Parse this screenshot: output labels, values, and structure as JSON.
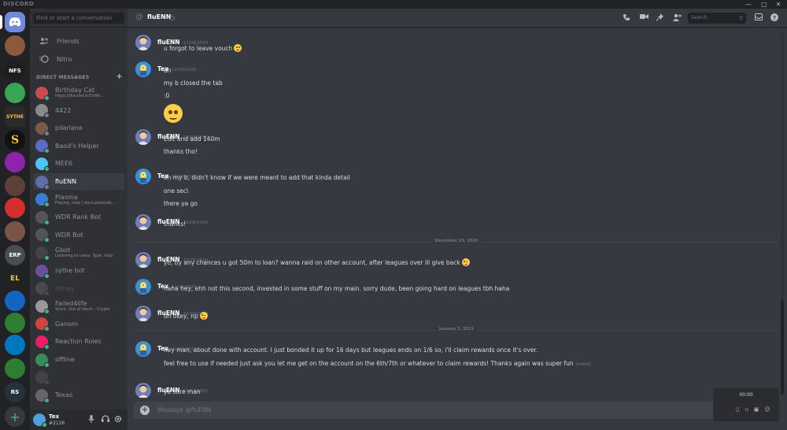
{
  "app": {
    "brand": "DISCORD"
  },
  "colors": {
    "accent": "#7289da",
    "online": "#43b581",
    "idle": "#faa61a",
    "dnd": "#f04747"
  },
  "window_controls": [
    "minimize-icon",
    "maximize-icon",
    "close-icon"
  ],
  "guilds": [
    {
      "label": "",
      "icon": "discord-home-icon"
    },
    {
      "label": "",
      "icon": "server-icon"
    },
    {
      "label": "NFS",
      "icon": "server-icon"
    },
    {
      "label": "",
      "icon": "server-icon"
    },
    {
      "label": "SYTHE",
      "icon": "server-icon"
    },
    {
      "label": "S",
      "icon": "server-icon"
    },
    {
      "label": "",
      "icon": "server-icon"
    },
    {
      "label": "",
      "icon": "server-icon"
    },
    {
      "label": "",
      "icon": "server-icon"
    },
    {
      "label": "",
      "icon": "server-icon"
    },
    {
      "label": "ERP",
      "icon": "server-icon"
    },
    {
      "label": "EL",
      "icon": "server-icon"
    },
    {
      "label": "",
      "icon": "server-icon"
    },
    {
      "label": "",
      "icon": "server-icon"
    },
    {
      "label": "",
      "icon": "server-icon"
    },
    {
      "label": "",
      "icon": "server-icon"
    },
    {
      "label": "RS",
      "icon": "server-icon"
    },
    {
      "label": "+",
      "icon": "add-server-icon"
    }
  ],
  "sidebar": {
    "search_placeholder": "Find or start a conversation",
    "nav": [
      {
        "label": "Friends",
        "icon": "friends-icon"
      },
      {
        "label": "Nitro",
        "icon": "nitro-icon"
      }
    ],
    "dm_header": "DIRECT MESSAGES",
    "dms": [
      {
        "name": "Birthday Cat",
        "sub": "https://discord.io/Orifle...",
        "status": "online",
        "color": "#c74b50"
      },
      {
        "name": "4422",
        "sub": "",
        "status": "offline",
        "color": "#8a8a8a"
      },
      {
        "name": "pilarlane",
        "sub": "",
        "status": "offline",
        "color": "#7a5a4a"
      },
      {
        "name": "Baod's Helper",
        "sub": "",
        "status": "online",
        "color": "#5c6bc0"
      },
      {
        "name": "MEE6",
        "sub": "",
        "status": "online",
        "color": "#4fc3f7"
      },
      {
        "name": "fluENN",
        "sub": "",
        "status": "offline",
        "color": "#5b6ea5",
        "active": true
      },
      {
        "name": "Plasma",
        "sub": "Playing .help | docs.plasmab...",
        "status": "online",
        "color": "#3a7bd5"
      },
      {
        "name": "WDR Rank Bot",
        "sub": "",
        "status": "online",
        "color": "#555"
      },
      {
        "name": "WDR Bot",
        "sub": "",
        "status": "online",
        "color": "#555"
      },
      {
        "name": "Gbot",
        "sub": "Listening to users. Type .help",
        "status": "online",
        "color": "#444"
      },
      {
        "name": "sythe bot",
        "sub": "",
        "status": "online",
        "color": "#6b4f9e"
      },
      {
        "name": "Winey",
        "sub": "",
        "status": "offline",
        "color": "#777",
        "faded": true
      },
      {
        "name": "Failed4life",
        "sub": "Stock: Out of Stock - Crypto",
        "status": "online",
        "color": "#999"
      },
      {
        "name": "Ganom",
        "sub": "",
        "status": "online",
        "color": "#d0443e"
      },
      {
        "name": "Reaction Roles",
        "sub": "",
        "status": "online",
        "color": "#e91e63"
      },
      {
        "name": "offline",
        "sub": "",
        "status": "online",
        "color": "#3b8a5a"
      },
      {
        "name": "",
        "sub": "",
        "status": "offline",
        "color": "#666",
        "faded": true
      },
      {
        "name": "Texas",
        "sub": "",
        "status": "online",
        "color": "#666"
      }
    ],
    "user": {
      "name": "Tex",
      "tag": "#2126"
    }
  },
  "header": {
    "channel": "fluENN",
    "search_placeholder": "Search"
  },
  "messages": [
    {
      "author": "fluENN",
      "ts": "12/08/2020",
      "avatar": "fluenn",
      "lines": [
        {
          "text": "u forgot to leave vouch",
          "emoji": "smile"
        }
      ]
    },
    {
      "author": "Tex",
      "ts": "12/08/2020",
      "avatar": "tex",
      "lines": [
        {
          "text": "ah"
        },
        {
          "text": "my b closed the tab"
        },
        {
          "text": ":0"
        },
        {
          "text": "",
          "emoji": "big"
        }
      ]
    },
    {
      "author": "fluENN",
      "ts": "12/08/2020",
      "avatar": "fluenn",
      "lines": [
        {
          "text": "Edit and add 140m"
        },
        {
          "text": "thanks tho!"
        }
      ]
    },
    {
      "author": "Tex",
      "ts": "12/08/2020",
      "avatar": "tex",
      "lines": [
        {
          "text": "oh my b, didn't know if we were meant to add that kinda detail"
        },
        {
          "text": "one sec\\"
        },
        {
          "text": "there ya go"
        }
      ]
    },
    {
      "author": "fluENN",
      "ts": "12/08/2020",
      "avatar": "fluenn",
      "lines": [
        {
          "text": "thanks!"
        }
      ]
    },
    {
      "divider": "December 29, 2020"
    },
    {
      "author": "fluENN",
      "ts": "12/29/2020",
      "avatar": "fluenn",
      "lines": [
        {
          "text": "yo, by any chances u got 50m to loan? wanna raid on other account, after leagues over ill give back",
          "emoji": "wink"
        }
      ]
    },
    {
      "author": "Tex",
      "ts": "12/29/2020",
      "avatar": "tex",
      "lines": [
        {
          "text": "haha hey, ehh not this second, invested in some stuff on my main. sorry dude, been going hard on leagues tbh haha"
        }
      ]
    },
    {
      "author": "fluENN",
      "ts": "12/29/2020",
      "avatar": "fluenn",
      "lines": [
        {
          "text": "oh okey, np",
          "emoji": "wink"
        }
      ]
    },
    {
      "divider": "January 3, 2021"
    },
    {
      "author": "Tex",
      "ts": "01/03/2021",
      "avatar": "tex",
      "lines": [
        {
          "text": "hey man, about done with account. I just bonded it up for 16 days but leagues ends on 1/6 so, i'll claim rewards once it's over."
        },
        {
          "text": "feel free to use if needed just ask you let me get on the account on the 6th/7th or whatever to claim rewards! Thanks again was super fun",
          "edited": "(edited)"
        }
      ]
    },
    {
      "author": "fluENN",
      "ts": "01/03/2021",
      "avatar": "fluenn",
      "lines": [
        {
          "text": "ye sure man"
        }
      ]
    }
  ],
  "composer": {
    "placeholder": "Message @fluENN"
  },
  "overlay": {
    "time": "00:00"
  }
}
